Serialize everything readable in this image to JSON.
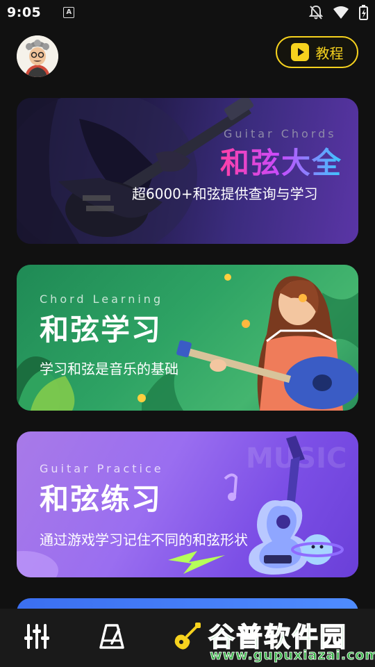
{
  "status_bar": {
    "time": "9:05",
    "notification_icon": "a-icon",
    "icons": [
      "bell-off-icon",
      "wifi-icon",
      "battery-icon"
    ]
  },
  "header": {
    "avatar_icon": "avatar",
    "tutorial_label": "教程",
    "tutorial_icon": "play-icon"
  },
  "cards": [
    {
      "subtitle_en": "Guitar Chords",
      "title": "和弦大全",
      "description": "超6000+和弦提供查询与学习"
    },
    {
      "subtitle_en": "Chord Learning",
      "title": "和弦学习",
      "description": "学习和弦是音乐的基础"
    },
    {
      "subtitle_en": "Guitar Practice",
      "title": "和弦练习",
      "description": "通过游戏学习记住不同的和弦形状"
    }
  ],
  "bottom_nav": {
    "items": [
      {
        "icon": "sliders-icon"
      },
      {
        "icon": "metronome-icon"
      },
      {
        "icon": "guitar-icon"
      }
    ],
    "active_color": "#f6d21e"
  },
  "watermark": {
    "title": "谷普软件园",
    "url": "www.gupuxiazai.com"
  },
  "colors": {
    "accent": "#f6d21e",
    "background": "#111111"
  }
}
